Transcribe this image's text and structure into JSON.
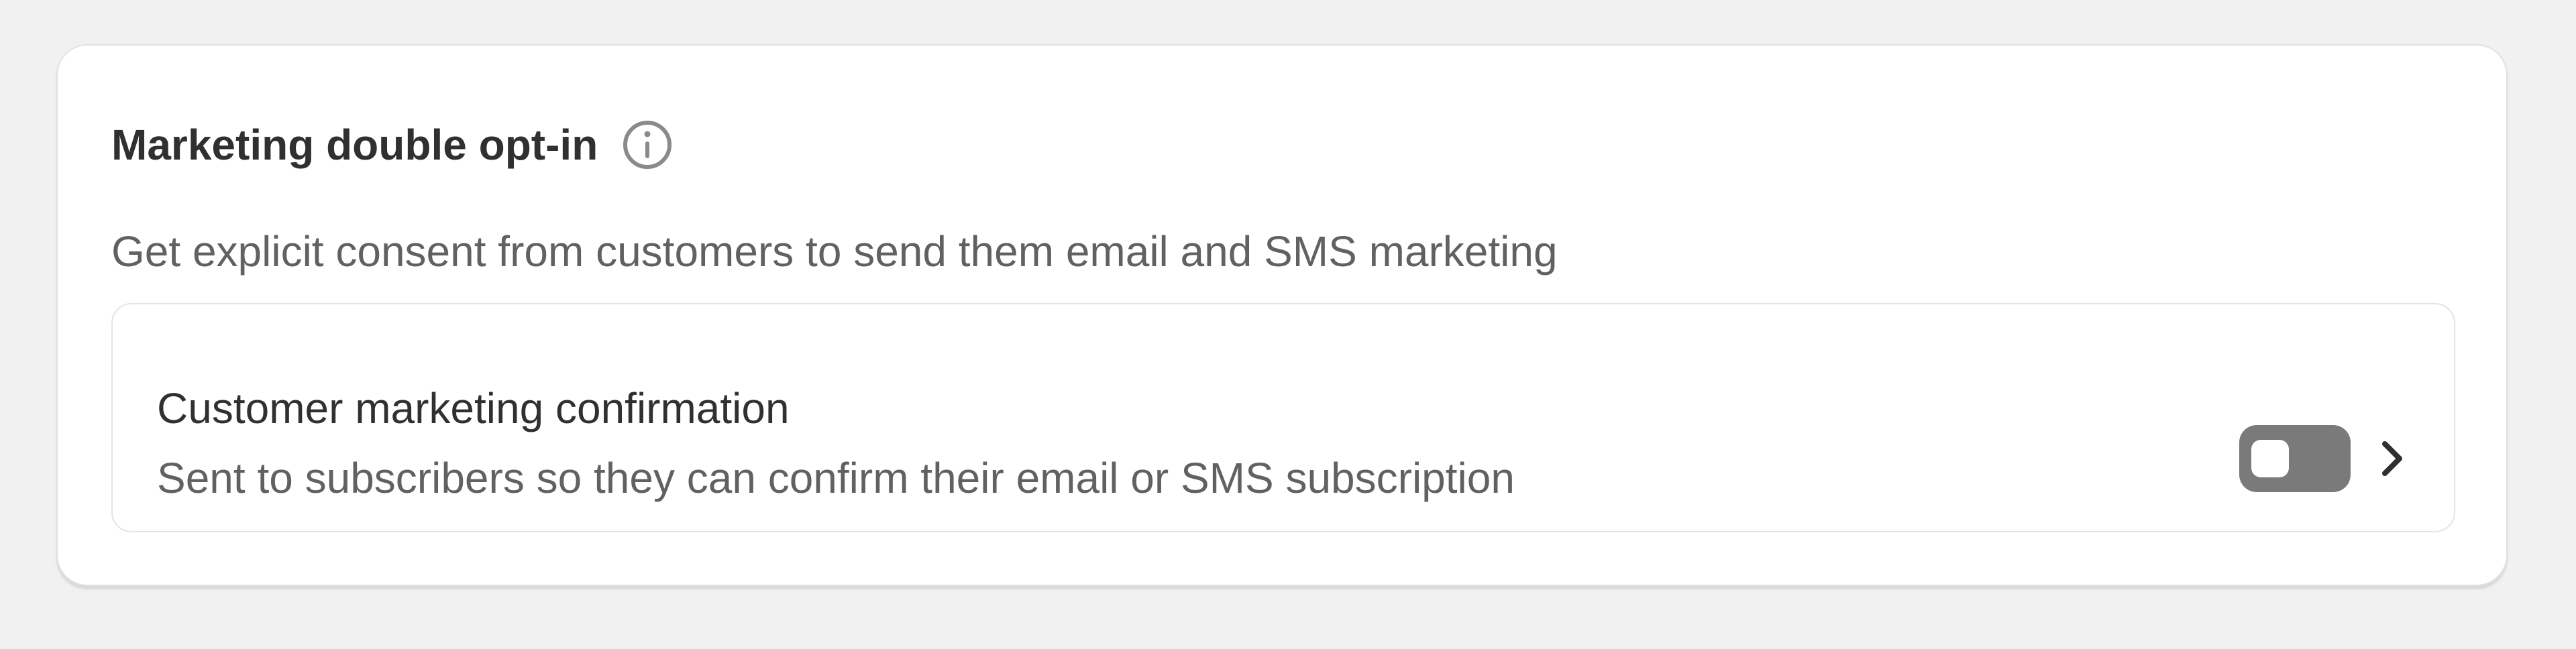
{
  "card": {
    "title": "Marketing double opt-in",
    "info_icon": "info-circle-icon",
    "description": "Get explicit consent from customers to send them email and SMS marketing"
  },
  "setting": {
    "title": "Customer marketing confirmation",
    "subtitle": "Sent to subscribers so they can confirm their email or SMS subscription",
    "toggle_state": "off",
    "chevron_icon": "chevron-right-icon"
  },
  "colors": {
    "page_background": "#f1f1f1",
    "card_background": "#ffffff",
    "title_text": "#303030",
    "secondary_text": "#616161",
    "toggle_off": "#7a7a7a",
    "border": "#e1e1e1"
  }
}
